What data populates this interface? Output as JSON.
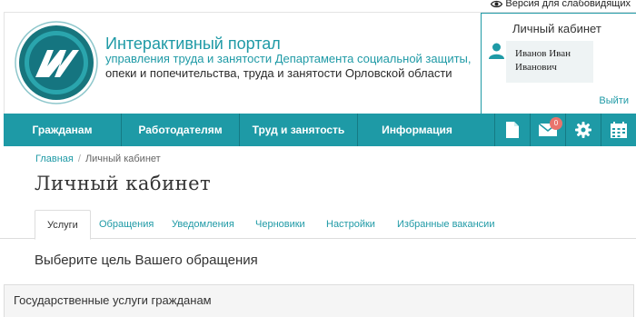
{
  "accessibility": {
    "label": "Версия для слабовидящих",
    "icon": "eye-icon"
  },
  "portal": {
    "title": "Интерактивный портал",
    "subtitle_line1": "управления труда и занятости Департамента социальной защиты,",
    "subtitle_line2": "опеки и попечительства, труда и занятости Орловской области"
  },
  "cabinet": {
    "title": "Личный кабинет",
    "user_name": "Иванов Иван Иванович",
    "logout_label": "Выйти"
  },
  "nav": {
    "items": [
      {
        "label": "Гражданам"
      },
      {
        "label": "Работодателям"
      },
      {
        "label": "Труд и занятость"
      },
      {
        "label": "Информация"
      }
    ],
    "icons": [
      {
        "name": "document-icon"
      },
      {
        "name": "mail-icon",
        "badge": "0"
      },
      {
        "name": "gear-icon"
      },
      {
        "name": "calendar-icon"
      }
    ]
  },
  "breadcrumb": {
    "home": "Главная",
    "current": "Личный кабинет"
  },
  "page": {
    "title": "Личный кабинет"
  },
  "tabs": [
    {
      "label": "Услуги",
      "active": true
    },
    {
      "label": "Обращения"
    },
    {
      "label": "Уведомления"
    },
    {
      "label": "Черновики"
    },
    {
      "label": "Настройки"
    },
    {
      "label": "Избранные вакансии"
    }
  ],
  "content": {
    "section_title": "Выберите цель Вашего обращения",
    "panel_title": "Государственные услуги гражданам"
  },
  "colors": {
    "accent": "#1e9aa6",
    "badge": "#e9746d"
  }
}
